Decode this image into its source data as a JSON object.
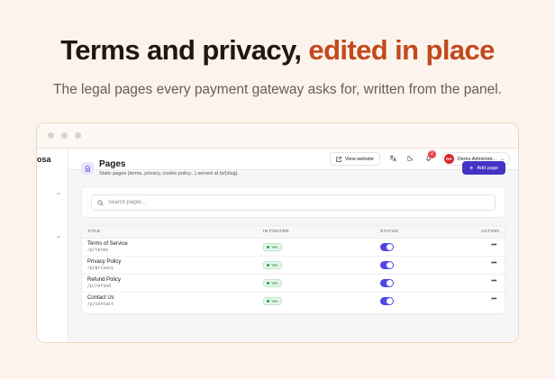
{
  "hero": {
    "title_plain": "Terms and privacy, ",
    "title_accent": "edited in place",
    "subtitle": "The legal pages every payment gateway asks for, written from the panel."
  },
  "sidebar": {
    "brand": "osa",
    "chevron": "⌄"
  },
  "topbar": {
    "view_website": "View website",
    "notif_count": "2",
    "user_initials": "DA",
    "user_name": "Demo Administr..."
  },
  "page": {
    "title": "Pages",
    "description": "Static pages (terms, privacy, cookie policy...) served at /p/{slug}.",
    "add_button": "Add page"
  },
  "search": {
    "placeholder": "Search pages..."
  },
  "table": {
    "headers": {
      "title": "TITLE",
      "in_footer": "IN FOOTER",
      "status": "STATUS",
      "action": "ACTION"
    },
    "rows": [
      {
        "title": "Terms of Service",
        "slug": "/p/terms",
        "footer": "Yes"
      },
      {
        "title": "Privacy Policy",
        "slug": "/p/privacy",
        "footer": "Yes"
      },
      {
        "title": "Refund Policy",
        "slug": "/p/refund",
        "footer": "Yes"
      },
      {
        "title": "Contact Us",
        "slug": "/p/contact",
        "footer": "Yes"
      }
    ]
  },
  "icons": {
    "external_link": "external-link-icon",
    "translate": "translate-icon",
    "theme": "moon-icon",
    "bell": "bell-icon",
    "page": "document-icon",
    "plus": "plus-icon",
    "search": "search-icon",
    "more": "more-horizontal-icon"
  },
  "colors": {
    "accent": "#c2491e",
    "primary": "#4433c4",
    "toggle_on": "#4f46e5",
    "success": "#22a04b"
  }
}
